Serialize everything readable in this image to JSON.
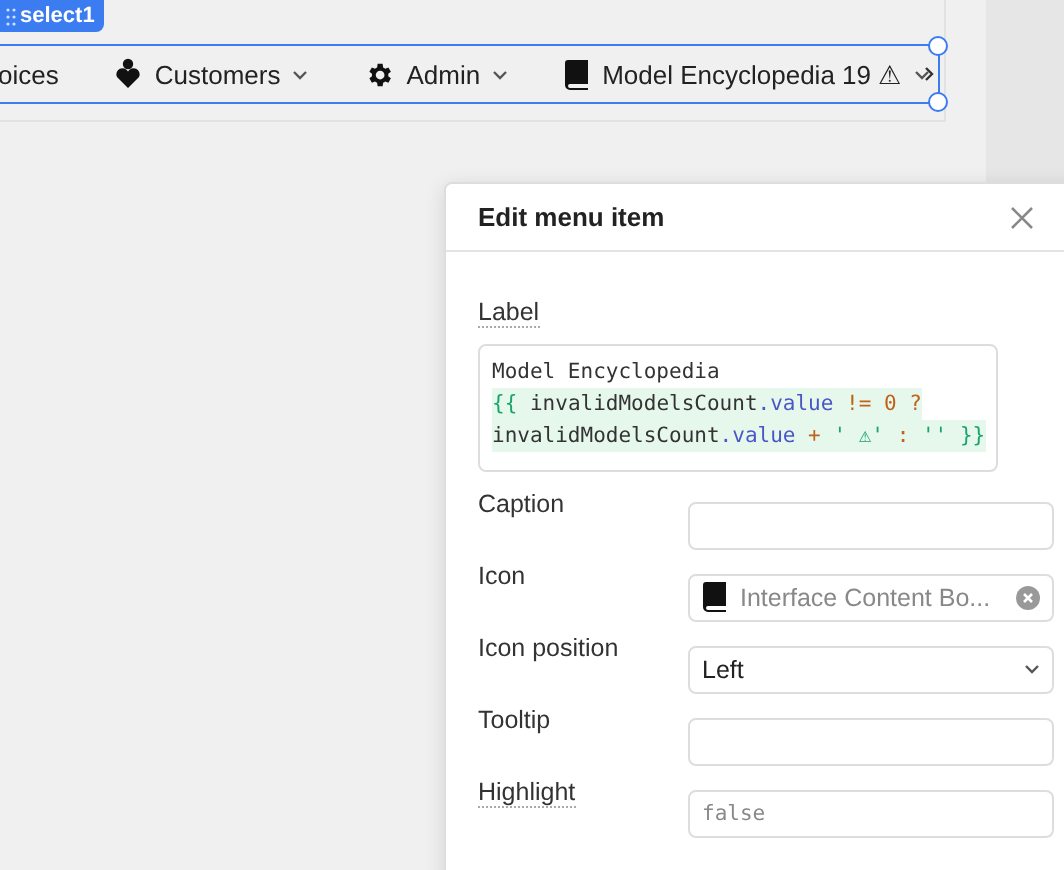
{
  "component_badge": {
    "label": "select1"
  },
  "menu_bar": {
    "items": [
      {
        "label": "oices",
        "caret": false
      },
      {
        "label": "Customers",
        "caret": true
      },
      {
        "label": "Admin",
        "caret": true
      },
      {
        "label": "Model Encyclopedia 19 ⚠",
        "caret": true
      }
    ]
  },
  "panel": {
    "title": "Edit menu item",
    "label_field": {
      "label": "Label",
      "has_hint": true,
      "code_lines": [
        [
          {
            "kind": "plain",
            "text": "Model Encyclopedia"
          }
        ],
        [
          {
            "kind": "brace",
            "text": "{{"
          },
          {
            "kind": "plain",
            "text": " invalidModelsCount"
          },
          {
            "kind": "prop",
            "text": ".value"
          },
          {
            "kind": "op",
            "text": " != 0 ?"
          }
        ],
        [
          {
            "kind": "plain",
            "text": "invalidModelsCount"
          },
          {
            "kind": "prop",
            "text": ".value"
          },
          {
            "kind": "op",
            "text": " + "
          },
          {
            "kind": "brace",
            "text": "' ⚠'"
          },
          {
            "kind": "op",
            "text": " : "
          },
          {
            "kind": "brace",
            "text": "''"
          },
          {
            "kind": "brace",
            "text": " }}"
          }
        ]
      ]
    },
    "fields": [
      {
        "kind": "text",
        "label": "Caption",
        "has_hint": false
      },
      {
        "kind": "icon",
        "label": "Icon",
        "has_hint": false,
        "value": "Interface Content Bo..."
      },
      {
        "kind": "select",
        "label": "Icon position",
        "has_hint": false,
        "value": "Left"
      },
      {
        "kind": "text",
        "label": "Tooltip",
        "has_hint": false
      },
      {
        "kind": "code",
        "label": "Highlight",
        "has_hint": true,
        "placeholder": "false"
      }
    ]
  }
}
